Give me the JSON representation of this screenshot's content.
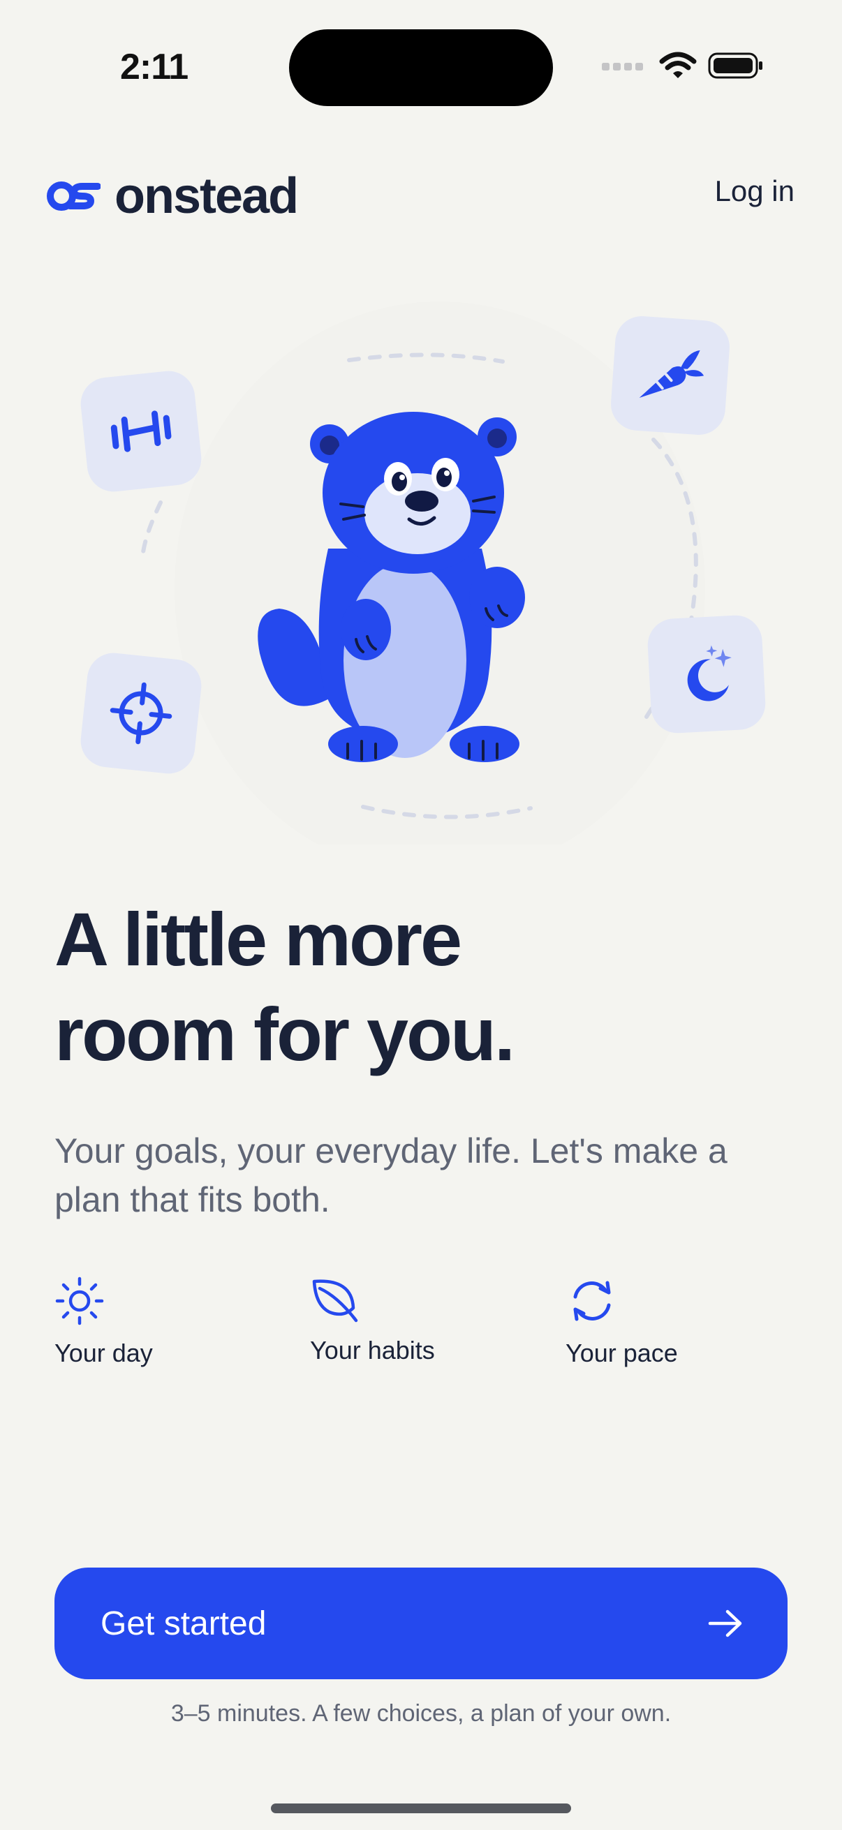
{
  "status_bar": {
    "time": "2:11"
  },
  "header": {
    "brand": "onstead",
    "login_label": "Log in"
  },
  "hero": {
    "icons": [
      "dumbbell-icon",
      "carrot-icon",
      "target-icon",
      "moon-stars-icon"
    ],
    "mascot": "otter"
  },
  "headline": {
    "line1": "A little more",
    "line2": "room for you."
  },
  "subtitle": "Your goals, your everyday life. Let's make a plan that fits both.",
  "features": [
    {
      "icon": "sun-icon",
      "label": "Your day"
    },
    {
      "icon": "leaf-icon",
      "label": "Your habits"
    },
    {
      "icon": "refresh-icon",
      "label": "Your pace"
    }
  ],
  "cta": {
    "label": "Get started",
    "footnote": "3–5 minutes. A few choices, a plan of your own."
  },
  "colors": {
    "accent": "#2549ee",
    "background": "#f4f4f0",
    "text": "#1a2238",
    "muted": "#5f6575",
    "chip": "#e3e7f6"
  }
}
